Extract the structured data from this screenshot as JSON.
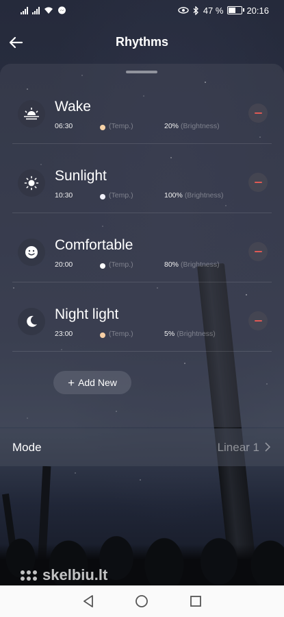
{
  "status_bar": {
    "battery": "47 %",
    "battery_level": 0.47,
    "time": "20:16"
  },
  "header": {
    "title": "Rhythms"
  },
  "rhythms": [
    {
      "name": "Wake",
      "time": "06:30",
      "temp_label": "(Temp.)",
      "temp_color": "#f6d2a8",
      "brightness": "20%",
      "brightness_label": "(Brightness)",
      "icon": "sunrise-icon"
    },
    {
      "name": "Sunlight",
      "time": "10:30",
      "temp_label": "(Temp.)",
      "temp_color": "#f0f0f8",
      "brightness": "100%",
      "brightness_label": "(Brightness)",
      "icon": "sun-icon"
    },
    {
      "name": "Comfortable",
      "time": "20:00",
      "temp_label": "(Temp.)",
      "temp_color": "#ffffff",
      "brightness": "80%",
      "brightness_label": "(Brightness)",
      "icon": "smiley-icon"
    },
    {
      "name": "Night light",
      "time": "23:00",
      "temp_label": "(Temp.)",
      "temp_color": "#f6cfa5",
      "brightness": "5%",
      "brightness_label": "(Brightness)",
      "icon": "moon-icon"
    }
  ],
  "add_button": {
    "label": "Add New"
  },
  "mode": {
    "label": "Mode",
    "value": "Linear 1"
  },
  "watermark": {
    "text": "skelbiu.lt"
  },
  "colors": {
    "remove_accent": "#e05a55",
    "background": "#1a1e2d"
  }
}
